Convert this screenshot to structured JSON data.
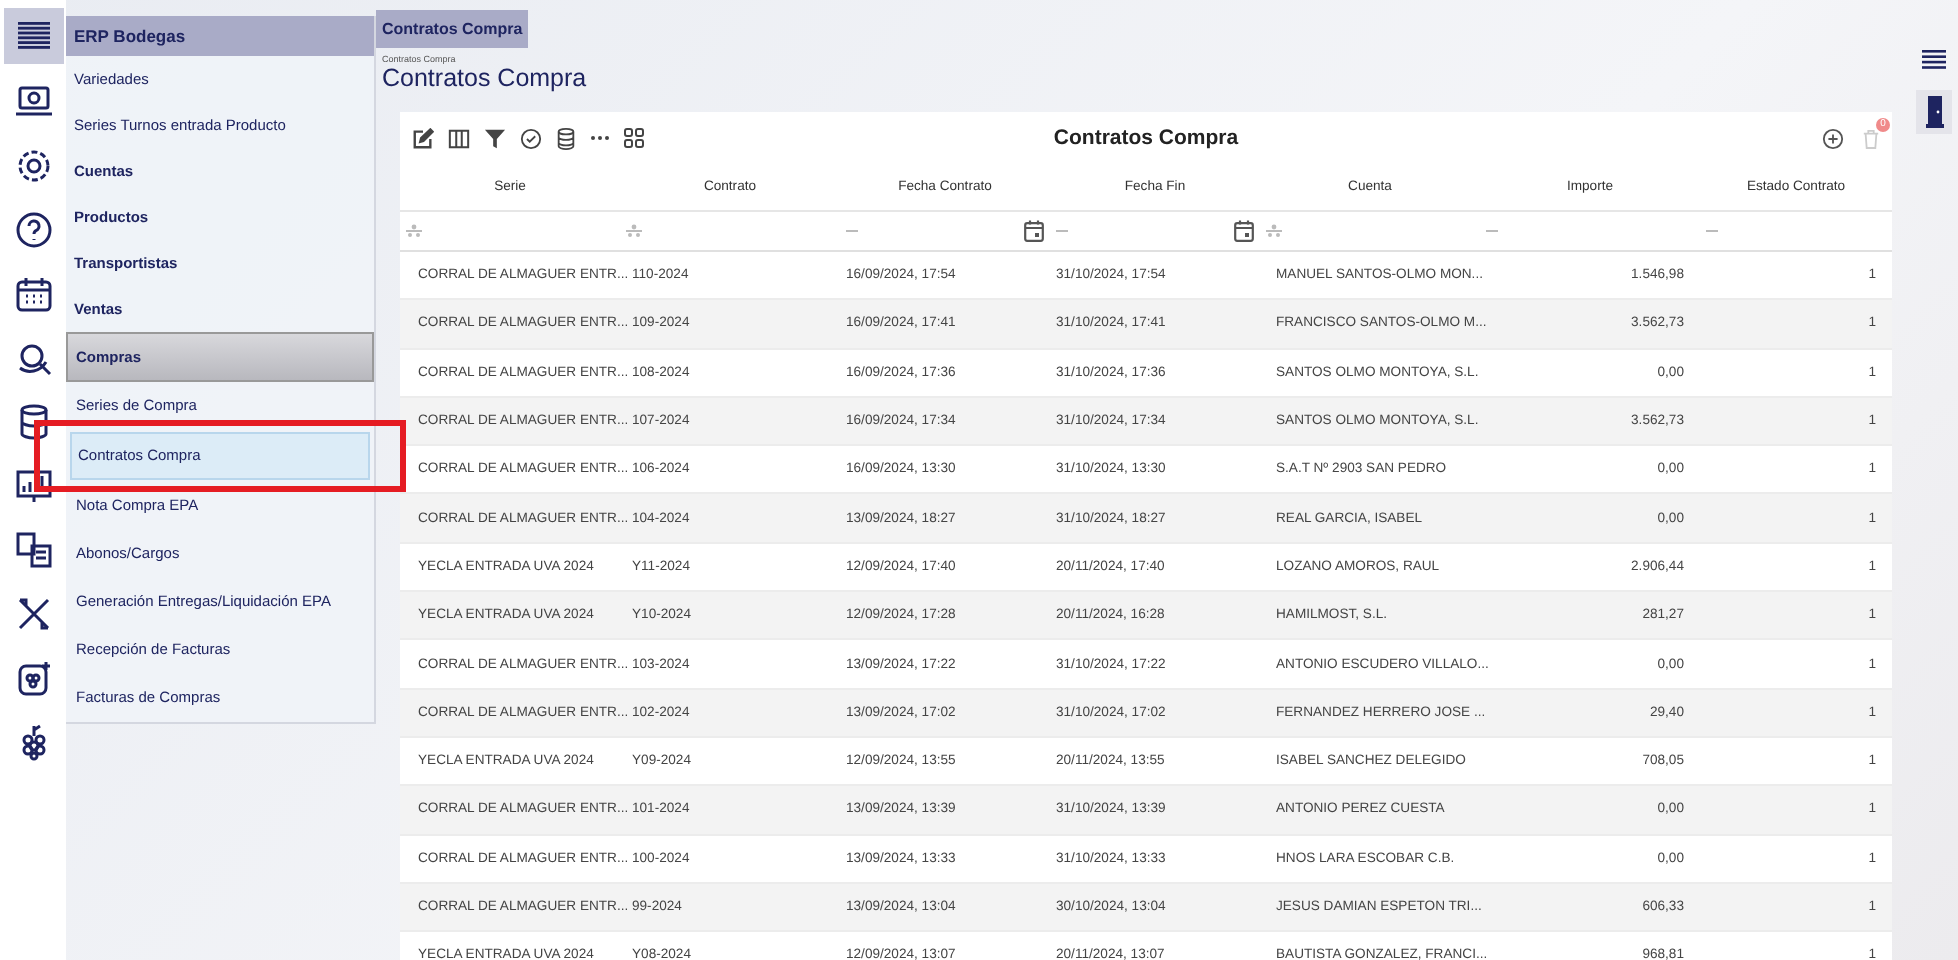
{
  "top_tab": {
    "label": "Contratos Compra",
    "selected": true
  },
  "sidebar": {
    "title": "ERP Bodegas",
    "items": [
      {
        "label": "Variedades",
        "kind": "item",
        "selected": false
      },
      {
        "label": "Series Turnos entrada Producto",
        "kind": "item",
        "selected": false
      },
      {
        "label": "Cuentas",
        "kind": "group",
        "selected": false
      },
      {
        "label": "Productos",
        "kind": "group",
        "selected": false
      },
      {
        "label": "Transportistas",
        "kind": "group",
        "selected": false
      },
      {
        "label": "Ventas",
        "kind": "group",
        "selected": false
      },
      {
        "label": "Compras",
        "kind": "group",
        "selected": true,
        "children": [
          {
            "label": "Series de Compra",
            "selected": false,
            "highlighted": false
          },
          {
            "label": "Contratos Compra",
            "selected": true,
            "highlighted": true
          },
          {
            "label": "Nota Compra EPA",
            "selected": false,
            "highlighted": false
          },
          {
            "label": "Abonos/Cargos",
            "selected": false,
            "highlighted": false
          },
          {
            "label": "Generación Entregas/Liquidación EPA",
            "selected": false,
            "highlighted": false
          },
          {
            "label": "Recepción de Facturas",
            "selected": false,
            "highlighted": false
          },
          {
            "label": "Facturas de Compras",
            "selected": false,
            "highlighted": false
          }
        ]
      }
    ]
  },
  "page": {
    "breadcrumb": "Contratos Compra",
    "title": "Contratos Compra"
  },
  "grid": {
    "title": "Contratos Compra",
    "delete_badge": "0",
    "columns": [
      {
        "label": "Serie",
        "kind": "text"
      },
      {
        "label": "Contrato",
        "kind": "text"
      },
      {
        "label": "Fecha Contrato",
        "kind": "date"
      },
      {
        "label": "Fecha Fin",
        "kind": "date"
      },
      {
        "label": "Cuenta",
        "kind": "text"
      },
      {
        "label": "Importe",
        "kind": "number"
      },
      {
        "label": "Estado Contrato",
        "kind": "number"
      }
    ],
    "rows": [
      [
        "CORRAL DE ALMAGUER ENTR...",
        "110-2024",
        "16/09/2024, 17:54",
        "31/10/2024, 17:54",
        "MANUEL SANTOS-OLMO MON...",
        "1.546,98",
        "1"
      ],
      [
        "CORRAL DE ALMAGUER ENTR...",
        "109-2024",
        "16/09/2024, 17:41",
        "31/10/2024, 17:41",
        "FRANCISCO SANTOS-OLMO M...",
        "3.562,73",
        "1"
      ],
      [
        "CORRAL DE ALMAGUER ENTR...",
        "108-2024",
        "16/09/2024, 17:36",
        "31/10/2024, 17:36",
        "SANTOS OLMO MONTOYA, S.L.",
        "0,00",
        "1"
      ],
      [
        "CORRAL DE ALMAGUER ENTR...",
        "107-2024",
        "16/09/2024, 17:34",
        "31/10/2024, 17:34",
        "SANTOS OLMO MONTOYA, S.L.",
        "3.562,73",
        "1"
      ],
      [
        "CORRAL DE ALMAGUER ENTR...",
        "106-2024",
        "16/09/2024, 13:30",
        "31/10/2024, 13:30",
        "S.A.T Nº 2903 SAN PEDRO",
        "0,00",
        "1"
      ],
      [
        "CORRAL DE ALMAGUER ENTR...",
        "104-2024",
        "13/09/2024, 18:27",
        "31/10/2024, 18:27",
        "REAL GARCIA, ISABEL",
        "0,00",
        "1"
      ],
      [
        "YECLA ENTRADA UVA 2024",
        "Y11-2024",
        "12/09/2024, 17:40",
        "20/11/2024, 17:40",
        "LOZANO AMOROS, RAUL",
        "2.906,44",
        "1"
      ],
      [
        "YECLA ENTRADA UVA 2024",
        "Y10-2024",
        "12/09/2024, 17:28",
        "20/11/2024, 16:28",
        "HAMILMOST, S.L.",
        "281,27",
        "1"
      ],
      [
        "CORRAL DE ALMAGUER ENTR...",
        "103-2024",
        "13/09/2024, 17:22",
        "31/10/2024, 17:22",
        "ANTONIO ESCUDERO VILLALO...",
        "0,00",
        "1"
      ],
      [
        "CORRAL DE ALMAGUER ENTR...",
        "102-2024",
        "13/09/2024, 17:02",
        "31/10/2024, 17:02",
        "FERNANDEZ HERRERO JOSE ...",
        "29,40",
        "1"
      ],
      [
        "YECLA ENTRADA UVA 2024",
        "Y09-2024",
        "12/09/2024, 13:55",
        "20/11/2024, 13:55",
        "ISABEL SANCHEZ DELEGIDO",
        "708,05",
        "1"
      ],
      [
        "CORRAL DE ALMAGUER ENTR...",
        "101-2024",
        "13/09/2024, 13:39",
        "31/10/2024, 13:39",
        "ANTONIO PEREZ CUESTA",
        "0,00",
        "1"
      ],
      [
        "CORRAL DE ALMAGUER ENTR...",
        "100-2024",
        "13/09/2024, 13:33",
        "31/10/2024, 13:33",
        "HNOS LARA ESCOBAR C.B.",
        "0,00",
        "1"
      ],
      [
        "CORRAL DE ALMAGUER ENTR...",
        "99-2024",
        "13/09/2024, 13:04",
        "30/10/2024, 13:04",
        "JESUS DAMIAN ESPETON TRI...",
        "606,33",
        "1"
      ],
      [
        "YECLA ENTRADA UVA 2024",
        "Y08-2024",
        "12/09/2024, 13:07",
        "20/11/2024, 13:07",
        "BAUTISTA GONZALEZ, FRANCI...",
        "968,81",
        "1"
      ]
    ]
  }
}
